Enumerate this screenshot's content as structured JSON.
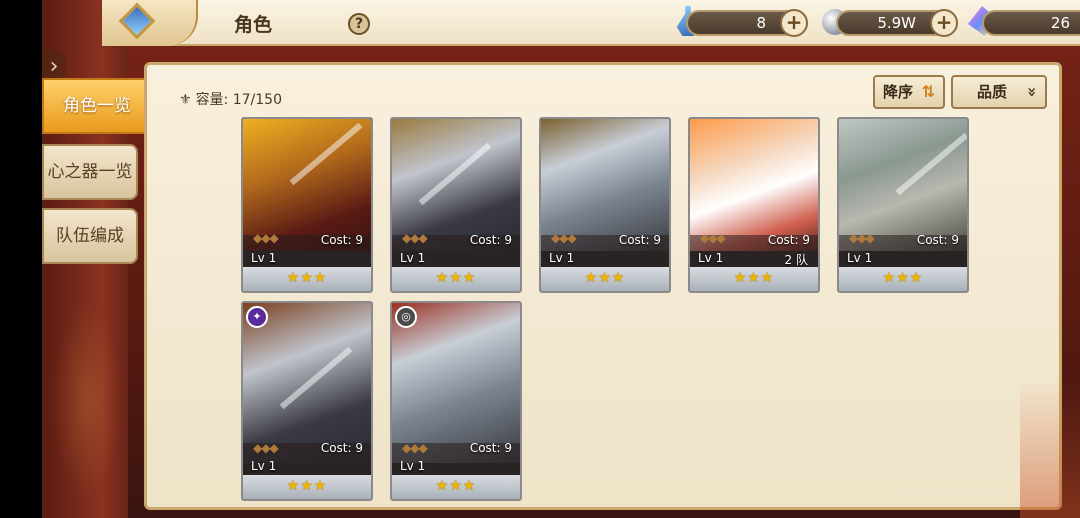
{
  "header": {
    "title": "角色",
    "help_label": "?",
    "resources": [
      {
        "name": "potion",
        "icon": "potion-icon",
        "value": "8"
      },
      {
        "name": "silver",
        "icon": "silver-orb-icon",
        "value": "5.9W"
      },
      {
        "name": "crystal",
        "icon": "crystal-icon",
        "value": "26"
      }
    ],
    "plus_label": "+"
  },
  "sidebar": {
    "expand_label": "›",
    "tabs": [
      {
        "label": "角色一览",
        "active": true
      },
      {
        "label": "心之器一览",
        "active": false
      },
      {
        "label": "队伍编成",
        "active": false
      }
    ]
  },
  "panel": {
    "capacity_label": "容量:",
    "capacity_value": "17/150",
    "sort_label": "降序",
    "sort_icon": "⇅",
    "filter_label": "品质",
    "filter_icon": "»"
  },
  "cards": [
    {
      "cost": "Cost: 9",
      "level": "Lv 1",
      "stars": "★★★",
      "team": ""
    },
    {
      "cost": "Cost: 9",
      "level": "Lv 1",
      "stars": "★★★",
      "team": ""
    },
    {
      "cost": "Cost: 9",
      "level": "Lv 1",
      "stars": "★★★",
      "team": ""
    },
    {
      "cost": "Cost: 9",
      "level": "Lv 1",
      "stars": "★★★",
      "team": "2 队"
    },
    {
      "cost": "Cost: 9",
      "level": "Lv 1",
      "stars": "★★★",
      "team": ""
    },
    {
      "cost": "Cost: 9",
      "level": "Lv 1",
      "stars": "★★★",
      "team": "",
      "badge_color": "#5a2a9a"
    },
    {
      "cost": "Cost: 9",
      "level": "Lv 1",
      "stars": "★★★",
      "team": "",
      "badge_color": "#4a4a4a"
    }
  ]
}
